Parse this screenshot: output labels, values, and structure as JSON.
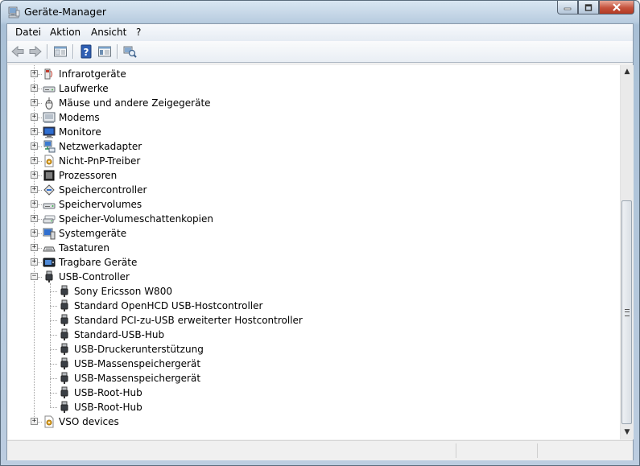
{
  "window": {
    "title": "Geräte-Manager"
  },
  "menu": [
    {
      "label": "Datei"
    },
    {
      "label": "Aktion"
    },
    {
      "label": "Ansicht"
    },
    {
      "label": "?"
    }
  ],
  "toolbar": [
    "back-icon",
    "forward-icon",
    "properties-view-icon",
    "help-icon",
    "console-tree-icon",
    "scan-hardware-icon"
  ],
  "tree": [
    {
      "label": "Infrarotgeräte",
      "icon": "infrared-icon",
      "expanded": false
    },
    {
      "label": "Laufwerke",
      "icon": "drive-icon",
      "expanded": false
    },
    {
      "label": "Mäuse und andere Zeigegeräte",
      "icon": "mouse-icon",
      "expanded": false
    },
    {
      "label": "Modems",
      "icon": "modem-icon",
      "expanded": false
    },
    {
      "label": "Monitore",
      "icon": "monitor-icon",
      "expanded": false
    },
    {
      "label": "Netzwerkadapter",
      "icon": "network-adapter-icon",
      "expanded": false
    },
    {
      "label": "Nicht-PnP-Treiber",
      "icon": "non-pnp-driver-icon",
      "expanded": false
    },
    {
      "label": "Prozessoren",
      "icon": "processor-icon",
      "expanded": false
    },
    {
      "label": "Speichercontroller",
      "icon": "storage-controller-icon",
      "expanded": false
    },
    {
      "label": "Speichervolumes",
      "icon": "storage-volume-icon",
      "expanded": false
    },
    {
      "label": "Speicher-Volumeschattenkopien",
      "icon": "shadow-copy-icon",
      "expanded": false
    },
    {
      "label": "Systemgeräte",
      "icon": "system-device-icon",
      "expanded": false
    },
    {
      "label": "Tastaturen",
      "icon": "keyboard-icon",
      "expanded": false
    },
    {
      "label": "Tragbare Geräte",
      "icon": "portable-device-icon",
      "expanded": false
    },
    {
      "label": "USB-Controller",
      "icon": "usb-icon",
      "expanded": true,
      "children": [
        {
          "label": "Sony Ericsson W800"
        },
        {
          "label": "Standard OpenHCD USB-Hostcontroller"
        },
        {
          "label": "Standard PCI-zu-USB erweiterter Hostcontroller"
        },
        {
          "label": "Standard-USB-Hub"
        },
        {
          "label": "USB-Druckerunterstützung"
        },
        {
          "label": "USB-Massenspeichergerät"
        },
        {
          "label": "USB-Massenspeichergerät"
        },
        {
          "label": "USB-Root-Hub"
        },
        {
          "label": "USB-Root-Hub"
        }
      ]
    },
    {
      "label": "VSO devices",
      "icon": "vso-device-icon",
      "expanded": false
    }
  ]
}
